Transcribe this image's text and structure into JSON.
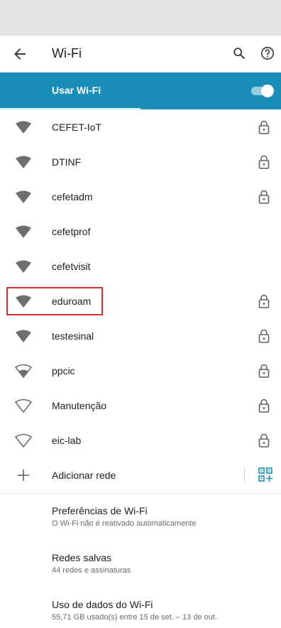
{
  "toolbar": {
    "title": "Wi-Fi",
    "back_icon": "arrow-back-icon",
    "search_icon": "search-icon",
    "help_icon": "help-icon"
  },
  "master_switch": {
    "label": "Usar Wi-Fi",
    "checked": true,
    "accent": "#1a8eb8"
  },
  "networks": [
    {
      "ssid": "CEFET-IoT",
      "signal": "full",
      "secured": true
    },
    {
      "ssid": "DTINF",
      "signal": "full",
      "secured": true
    },
    {
      "ssid": "cefetadm",
      "signal": "full",
      "secured": true
    },
    {
      "ssid": "cefetprof",
      "signal": "full",
      "secured": false
    },
    {
      "ssid": "cefetvisit",
      "signal": "full",
      "secured": false
    },
    {
      "ssid": "eduroam",
      "signal": "full",
      "secured": true,
      "highlighted": true
    },
    {
      "ssid": "testesinal",
      "signal": "full",
      "secured": true
    },
    {
      "ssid": "ppcic",
      "signal": "medium",
      "secured": true
    },
    {
      "ssid": "Manutenção",
      "signal": "none",
      "secured": true
    },
    {
      "ssid": "eic-lab",
      "signal": "none",
      "secured": true
    }
  ],
  "add_network": {
    "label": "Adicionar rede",
    "plus_icon": "plus-icon",
    "qr_icon": "qr-code-scan-icon"
  },
  "preferences": [
    {
      "title": "Preferências de Wi-Fi",
      "summary": "O Wi-Fi não é reativado automaticamente"
    },
    {
      "title": "Redes salvas",
      "summary": "44 redes e assinaturas"
    },
    {
      "title": "Uso de dados do Wi-Fi",
      "summary": "55,71 GB usado(s) entre 15 de set. – 13 de out."
    }
  ],
  "colors": {
    "highlight_border": "#d0323a",
    "icon_gray": "#6e6e6e"
  }
}
